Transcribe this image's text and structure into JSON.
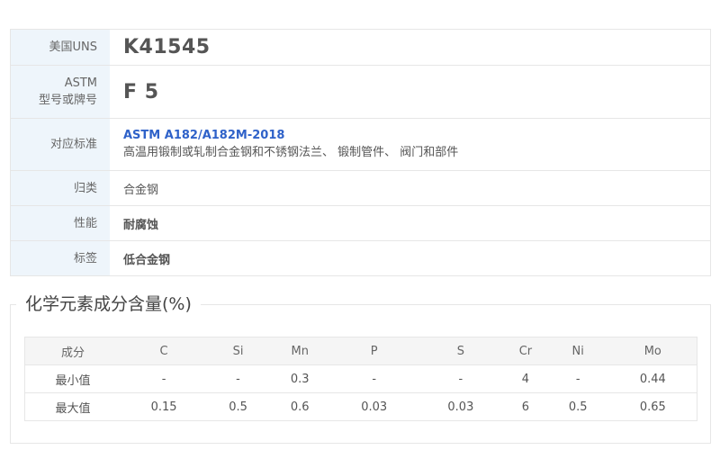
{
  "info": {
    "uns_label": "美国UNS",
    "uns_value": "K41545",
    "astm_label_line1": "ASTM",
    "astm_label_line2": "型号或牌号",
    "astm_value": "F 5",
    "standard_label": "对应标准",
    "standard_code": "ASTM A182/A182M-2018",
    "standard_name": "高温用锻制或轧制合金钢和不锈钢法兰、 锻制管件、 阀门和部件",
    "category_label": "归类",
    "category_value": "合金钢",
    "property_label": "性能",
    "property_value": "耐腐蚀",
    "tag_label": "标签",
    "tag_value": "低合金钢"
  },
  "chemistry": {
    "title": "化学元素成分含量(%)",
    "headers": [
      "成分",
      "C",
      "Si",
      "Mn",
      "P",
      "S",
      "Cr",
      "Ni",
      "Mo"
    ],
    "rows": [
      [
        "最小值",
        "-",
        "-",
        "0.3",
        "-",
        "-",
        "4",
        "-",
        "0.44"
      ],
      [
        "最大值",
        "0.15",
        "0.5",
        "0.6",
        "0.03",
        "0.03",
        "6",
        "0.5",
        "0.65"
      ]
    ]
  },
  "colors": {
    "label_bg": "#eef5fb",
    "link": "#2f62c9",
    "border": "#e6e6e6"
  }
}
